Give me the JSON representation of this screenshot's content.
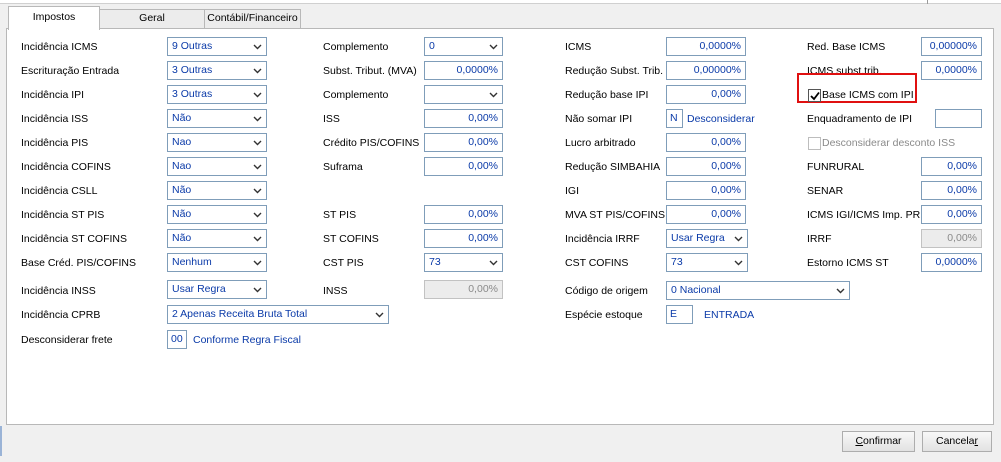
{
  "tabs": {
    "impostos": "Impostos",
    "geral": "Geral",
    "contabil": "Contábil/Financeiro"
  },
  "col1": {
    "incidencia_icms": {
      "label": "Incidência ICMS",
      "value": "9 Outras"
    },
    "escrituracao_entrada": {
      "label": "Escrituração Entrada",
      "value": "3 Outras"
    },
    "incidencia_ipi": {
      "label": "Incidência IPI",
      "value": "3 Outras"
    },
    "incidencia_iss": {
      "label": "Incidência ISS",
      "value": "Não"
    },
    "incidencia_pis": {
      "label": "Incidência PIS",
      "value": "Nao"
    },
    "incidencia_cofins": {
      "label": "Incidência COFINS",
      "value": "Nao"
    },
    "incidencia_csll": {
      "label": "Incidência CSLL",
      "value": "Não"
    },
    "incidencia_st_pis": {
      "label": "Incidência ST PIS",
      "value": "Não"
    },
    "incidencia_st_cofins": {
      "label": "Incidência ST COFINS",
      "value": "Não"
    },
    "base_cred_pis_cofins": {
      "label": "Base Créd. PIS/COFINS",
      "value": "Nenhum"
    },
    "incidencia_inss": {
      "label": "Incidência INSS",
      "value": "Usar Regra"
    },
    "incidencia_cprb": {
      "label": "Incidência CPRB",
      "value": "2 Apenas Receita Bruta Total"
    },
    "desconsiderar_frete": {
      "label": "Desconsiderar frete",
      "code": "00",
      "text": "Conforme Regra Fiscal"
    }
  },
  "col2": {
    "complemento_icms": {
      "label": "Complemento",
      "value": "0"
    },
    "subst_tribut_mva": {
      "label": "Subst. Tribut. (MVA)",
      "value": "0,0000%"
    },
    "complemento_ipi": {
      "label": "Complemento",
      "value": ""
    },
    "iss": {
      "label": "ISS",
      "value": "0,00%"
    },
    "credito_pis_cofins": {
      "label": "Crédito PIS/COFINS",
      "value": "0,00%"
    },
    "suframa": {
      "label": "Suframa",
      "value": "0,00%"
    },
    "st_pis": {
      "label": "ST PIS",
      "value": "0,00%"
    },
    "st_cofins": {
      "label": "ST COFINS",
      "value": "0,00%"
    },
    "cst_pis": {
      "label": "CST PIS",
      "value": "73"
    },
    "inss": {
      "label": "INSS",
      "value": "0,00%"
    }
  },
  "col3": {
    "icms": {
      "label": "ICMS",
      "value": "0,0000%"
    },
    "reducao_subst_trib": {
      "label": "Redução Subst. Trib.",
      "value": "0,00000%"
    },
    "reducao_base_ipi": {
      "label": "Redução base IPI",
      "value": "0,00%"
    },
    "nao_somar_ipi": {
      "label": "Não somar IPI",
      "code": "N",
      "text": "Desconsiderar"
    },
    "lucro_arbitrado": {
      "label": "Lucro arbitrado",
      "value": "0,00%"
    },
    "reducao_simbahia": {
      "label": "Redução SIMBAHIA",
      "value": "0,00%"
    },
    "igi": {
      "label": "IGI",
      "value": "0,00%"
    },
    "mva_st_pis_cofins": {
      "label": "MVA ST PIS/COFINS",
      "value": "0,00%"
    },
    "incidencia_irrf": {
      "label": "Incidência IRRF",
      "value": "Usar Regra"
    },
    "cst_cofins": {
      "label": "CST COFINS",
      "value": "73"
    },
    "codigo_origem": {
      "label": "Código de origem",
      "value": "0 Nacional"
    },
    "especie_estoque": {
      "label": "Espécie estoque",
      "code": "E",
      "text": "ENTRADA"
    }
  },
  "col4": {
    "red_base_icms": {
      "label": "Red. Base ICMS",
      "value": "0,00000%"
    },
    "icms_subst_trib": {
      "label": "ICMS subst.trib.",
      "value": "0,0000%"
    },
    "base_icms_com_ipi": {
      "label": "Base ICMS com IPI",
      "checked": true
    },
    "enquadramento_ipi": {
      "label": "Enquadramento de IPI",
      "value": ""
    },
    "desconsiderar_desconto_iss": {
      "label": "Desconsiderar desconto ISS",
      "checked": false
    },
    "funrural": {
      "label": "FUNRURAL",
      "value": "0,00%"
    },
    "senar": {
      "label": "SENAR",
      "value": "0,00%"
    },
    "icms_igi_imp_pr": {
      "label": "ICMS IGI/ICMS Imp. PR",
      "value": "0,00%"
    },
    "irrf": {
      "label": "IRRF",
      "value": "0,00%"
    },
    "estorno_icms_st": {
      "label": "Estorno ICMS ST",
      "value": "0,0000%"
    }
  },
  "buttons": {
    "confirmar_first": "C",
    "confirmar_rest": "onfirmar",
    "cancelar_start": "Cancela",
    "cancelar_u": "r"
  },
  "colors": {
    "value_text": "#0a3aa8",
    "highlight": "#e01010",
    "field_border": "#7f9db9"
  }
}
